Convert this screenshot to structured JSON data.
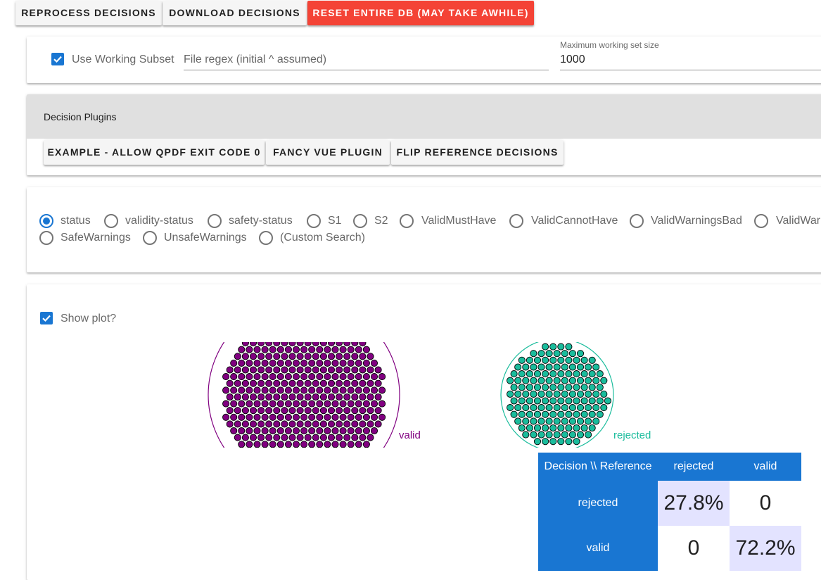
{
  "toolbar": {
    "reprocess_label": "Reprocess Decisions",
    "download_label": "Download Decisions",
    "reset_label": "Reset Entire DB (May take awhile)"
  },
  "working_subset": {
    "checkbox_label": "Use Working Subset",
    "checked": true,
    "file_regex_placeholder": "File regex (initial ^ assumed)",
    "max_size_label": "Maximum working set size",
    "max_size_value": "1000"
  },
  "plugins": {
    "header": "Decision Plugins",
    "buttons": [
      {
        "label": "Example - Allow qpdf exit code 0"
      },
      {
        "label": "Fancy Vue Plugin"
      },
      {
        "label": "Flip Reference Decisions"
      }
    ]
  },
  "decision_select": {
    "selected": "status",
    "options": [
      {
        "label": "status"
      },
      {
        "label": "validity-status"
      },
      {
        "label": "safety-status"
      },
      {
        "label": "S1"
      },
      {
        "label": "S2"
      },
      {
        "label": "ValidMustHave"
      },
      {
        "label": "ValidCannotHave"
      },
      {
        "label": "ValidWarningsBad"
      },
      {
        "label": "ValidWarningsOk"
      },
      {
        "label": "SafeWarnings"
      },
      {
        "label": "UnsafeWarnings"
      },
      {
        "label": "(Custom Search)"
      }
    ]
  },
  "plot": {
    "show_label": "Show plot?",
    "checked": true,
    "clusters": [
      {
        "label": "valid",
        "color": "#800080"
      },
      {
        "label": "rejected",
        "color": "#1abc9c"
      }
    ]
  },
  "confusion_matrix": {
    "corner": "Decision \\\\ Reference",
    "col_headers": [
      "rejected",
      "valid"
    ],
    "rows": [
      {
        "label": "rejected",
        "values": [
          "27.8%",
          "0"
        ]
      },
      {
        "label": "valid",
        "values": [
          "0",
          "72.2%"
        ]
      }
    ]
  },
  "colors": {
    "primary": "#1976d2",
    "danger": "#f44336",
    "valid_cluster": "#800080",
    "rejected_cluster": "#1abc9c"
  }
}
